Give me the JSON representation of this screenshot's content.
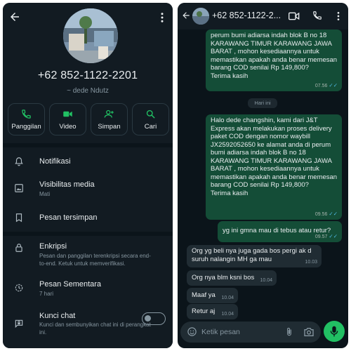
{
  "contact_info": {
    "phone": "+62 852-1122-2201",
    "nickname": "~ dede Ndutz",
    "actions": [
      {
        "label": "Panggilan",
        "icon": "phone-icon"
      },
      {
        "label": "Video",
        "icon": "video-icon"
      },
      {
        "label": "Simpan",
        "icon": "add-contact-icon"
      },
      {
        "label": "Cari",
        "icon": "search-icon"
      }
    ],
    "settings": [
      {
        "title": "Notifikasi",
        "subtitle": "",
        "icon": "bell-icon"
      },
      {
        "title": "Visibilitas media",
        "subtitle": "Mati",
        "icon": "image-icon"
      },
      {
        "title": "Pesan tersimpan",
        "subtitle": "",
        "icon": "bookmark-icon"
      }
    ],
    "privacy": [
      {
        "title": "Enkripsi",
        "subtitle": "Pesan dan panggilan terenkripsi secara end-to-end. Ketuk untuk memverifikasi.",
        "icon": "lock-icon"
      },
      {
        "title": "Pesan Sementara",
        "subtitle": "7 hari",
        "icon": "timer-icon"
      },
      {
        "title": "Kunci chat",
        "subtitle": "Kunci dan sembunyikan chat ini di perangkat ini.",
        "icon": "chat-lock-icon",
        "toggle_on": false
      }
    ]
  },
  "chat": {
    "contact_name": "+62 852-1122-2...",
    "date_chip": "Hari ini",
    "input_placeholder": "Ketik pesan",
    "messages": [
      {
        "direction": "out",
        "text": "perum bumi adiarsa indah blok B no 18 KARAWANG TIMUR KARAWANG JAWA BARAT , mohon kesediaannya untuk memastikan apakah anda benar memesan barang COD senilai Rp 149,800?\nTerima kasih",
        "time": "07.56"
      },
      {
        "direction": "out",
        "text": "Halo dede changshin, kami dari J&T Express akan melakukan proses delivery paket COD dengan nomor waybill JX2592052650 ke alamat anda di perum bumi adiarsa indah blok B no 18 KARAWANG TIMUR KARAWANG JAWA BARAT , mohon kesediaannya untuk memastikan apakah anda benar memesan barang COD senilai Rp 149,800?\nTerima kasih",
        "time": "09.56"
      },
      {
        "direction": "out",
        "text": "yg ini gmna mau di tebus atau retur?",
        "time": "09.57"
      },
      {
        "direction": "in",
        "text": "Org yg beli nya juga gada bos pergi ak d suruh nalangin MH ga mau",
        "time": "10.03"
      },
      {
        "direction": "in",
        "text": "Org nya blm ksni bos",
        "time": "10.04"
      },
      {
        "direction": "in",
        "text": "Maaf ya",
        "time": "10.04"
      },
      {
        "direction": "in",
        "text": "Retur aj",
        "time": "10.04"
      }
    ]
  },
  "colors": {
    "background": "#0b141a",
    "surface": "#121b22",
    "outgoing_bubble": "#144d37",
    "incoming_bubble": "#202c33",
    "accent": "#21c063",
    "read_tick": "#53bdeb"
  }
}
